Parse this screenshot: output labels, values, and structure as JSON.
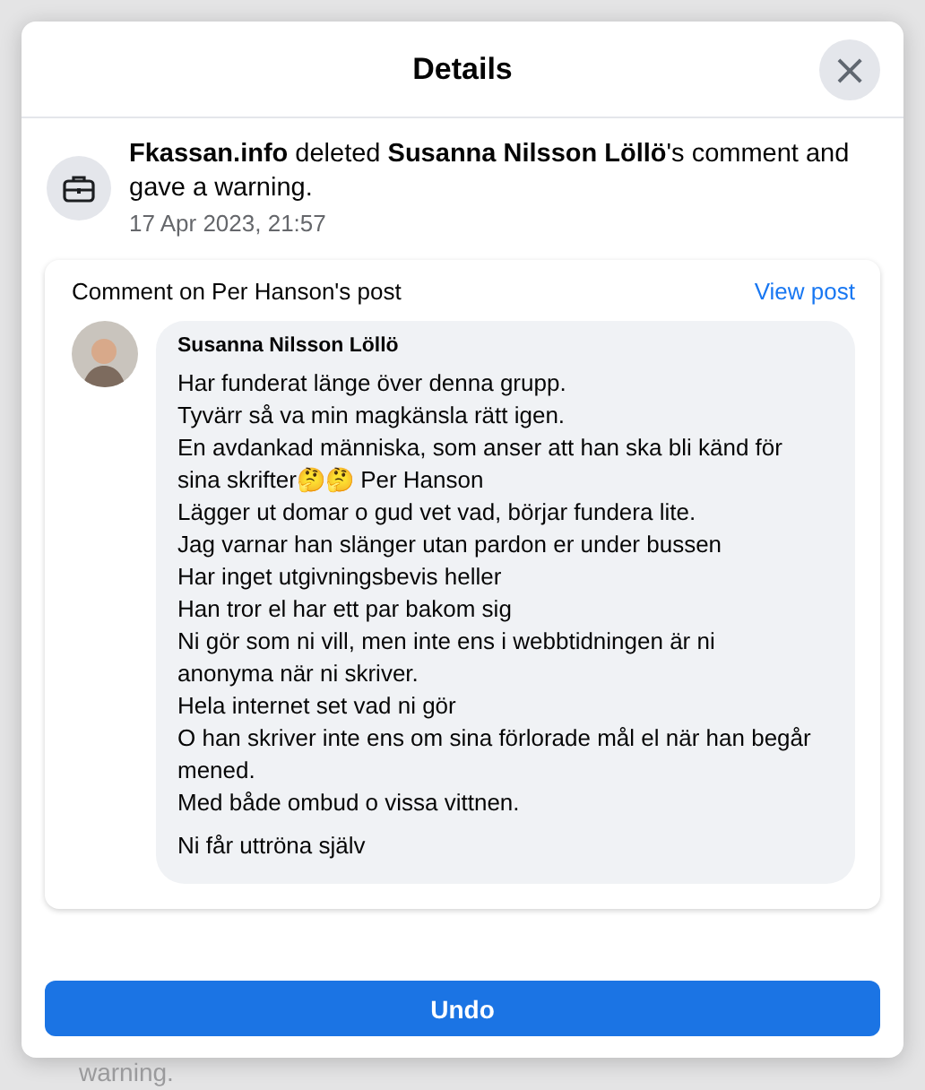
{
  "dialog": {
    "title": "Details",
    "close_label": "×"
  },
  "activity": {
    "actor": "Fkassan.info",
    "action_1": " deleted ",
    "target": "Susanna Nilsson Löllö",
    "action_2": "'s comment and gave a warning.",
    "time": "17 Apr 2023, 21:57"
  },
  "comment_card": {
    "heading": "Comment on Per Hanson's post",
    "link": "View post",
    "author": "Susanna Nilsson Löllö",
    "paragraphs": [
      [
        "Har funderat länge över denna grupp.",
        "Tyvärr så va min magkänsla rätt igen.",
        "En avdankad människa, som anser att han ska bli känd för",
        "sina skrifter🤔🤔 Per Hanson",
        "Lägger ut domar o gud vet vad, börjar fundera lite.",
        "Jag varnar han slänger utan pardon er under bussen",
        "Har inget utgivningsbevis heller",
        "Han tror el har ett par bakom sig",
        "Ni gör som ni vill, men inte ens i webbtidningen är ni",
        "anonyma när ni skriver.",
        "Hela internet set vad ni gör",
        "O han skriver inte ens om sina förlorade mål el när han begår",
        "mened.",
        "Med både ombud o vissa vittnen."
      ],
      [
        "Ni får uttröna själv"
      ]
    ]
  },
  "button": {
    "label": "Undo"
  },
  "background_text": "warning."
}
